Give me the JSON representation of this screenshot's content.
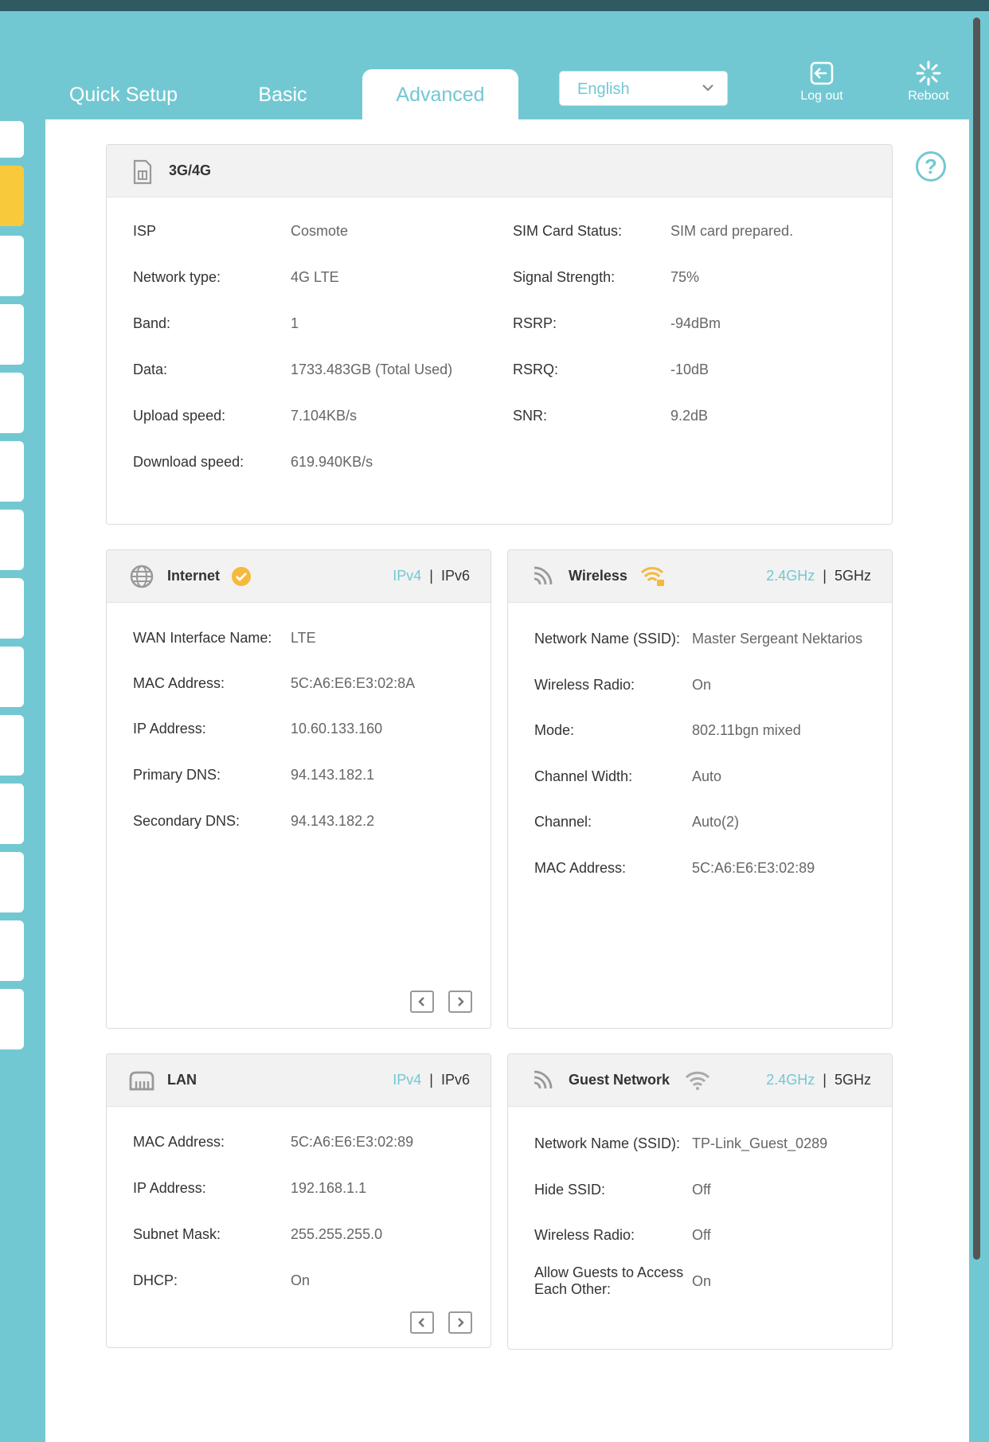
{
  "nav": {
    "tabs": [
      {
        "label": "Quick Setup"
      },
      {
        "label": "Basic"
      },
      {
        "label": "Advanced"
      }
    ],
    "language": "English",
    "logout_label": "Log out",
    "reboot_label": "Reboot"
  },
  "cellular": {
    "title": "3G/4G",
    "left": [
      {
        "label": "ISP",
        "value": "Cosmote"
      },
      {
        "label": "Network type:",
        "value": "4G LTE"
      },
      {
        "label": "Band:",
        "value": "1"
      },
      {
        "label": "Data:",
        "value": "1733.483GB (Total Used)"
      },
      {
        "label": "Upload speed:",
        "value": "7.104KB/s"
      },
      {
        "label": "Download speed:",
        "value": "619.940KB/s"
      }
    ],
    "right": [
      {
        "label": "SIM Card Status:",
        "value": "SIM card prepared."
      },
      {
        "label": "Signal Strength:",
        "value": "75%"
      },
      {
        "label": "RSRP:",
        "value": "-94dBm"
      },
      {
        "label": "RSRQ:",
        "value": "-10dB"
      },
      {
        "label": "SNR:",
        "value": "9.2dB"
      }
    ]
  },
  "internet": {
    "title": "Internet",
    "switch_a": "IPv4",
    "switch_b": "IPv6",
    "rows": [
      {
        "label": "WAN Interface Name:",
        "value": "LTE"
      },
      {
        "label": "MAC Address:",
        "value": "5C:A6:E6:E3:02:8A"
      },
      {
        "label": "IP Address:",
        "value": "10.60.133.160"
      },
      {
        "label": "Primary DNS:",
        "value": "94.143.182.1"
      },
      {
        "label": "Secondary DNS:",
        "value": "94.143.182.2"
      }
    ]
  },
  "wireless": {
    "title": "Wireless",
    "switch_a": "2.4GHz",
    "switch_b": "5GHz",
    "rows": [
      {
        "label": "Network Name (SSID):",
        "value": "Master Sergeant Nektarios"
      },
      {
        "label": "Wireless Radio:",
        "value": "On"
      },
      {
        "label": "Mode:",
        "value": "802.11bgn mixed"
      },
      {
        "label": "Channel Width:",
        "value": "Auto"
      },
      {
        "label": "Channel:",
        "value": "Auto(2)"
      },
      {
        "label": "MAC Address:",
        "value": "5C:A6:E6:E3:02:89"
      }
    ]
  },
  "lan": {
    "title": "LAN",
    "switch_a": "IPv4",
    "switch_b": "IPv6",
    "rows": [
      {
        "label": "MAC Address:",
        "value": "5C:A6:E6:E3:02:89"
      },
      {
        "label": "IP Address:",
        "value": "192.168.1.1"
      },
      {
        "label": "Subnet Mask:",
        "value": "255.255.255.0"
      },
      {
        "label": "DHCP:",
        "value": "On"
      }
    ]
  },
  "guest": {
    "title": "Guest Network",
    "switch_a": "2.4GHz",
    "switch_b": "5GHz",
    "rows": [
      {
        "label": "Network Name (SSID):",
        "value": "TP-Link_Guest_0289"
      },
      {
        "label": "Hide SSID:",
        "value": "Off"
      },
      {
        "label": "Wireless Radio:",
        "value": "Off"
      },
      {
        "label": "Allow Guests to Access",
        "label2": "Each Other:",
        "value": "On"
      }
    ]
  },
  "colors": {
    "accent": "#72c8d2",
    "active_rail": "#f9c93c",
    "status_ok": "#f6b93b"
  }
}
